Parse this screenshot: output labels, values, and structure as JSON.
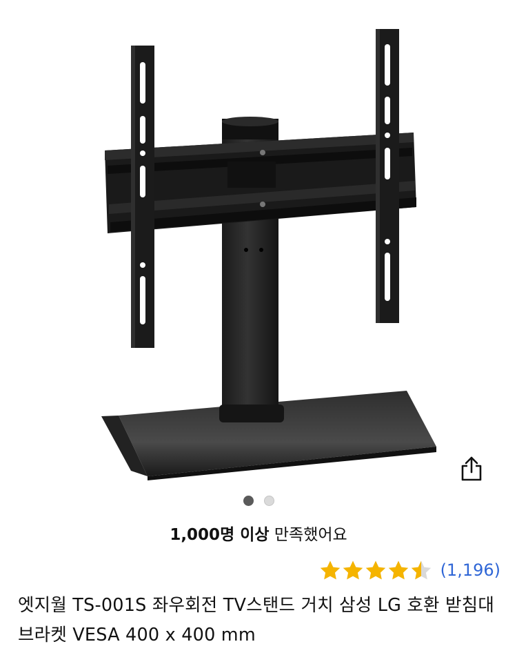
{
  "product": {
    "image_alt": "TV stand with VESA bracket",
    "gallery_count": 2,
    "gallery_active_index": 0
  },
  "satisfaction": {
    "count": "1,000명 이상",
    "suffix": " 만족했어요"
  },
  "rating": {
    "score": 4.5,
    "max": 5,
    "review_count": "(1,196)",
    "star_color": "#f5b400",
    "star_empty_color": "#d9d9d9"
  },
  "title": "엣지월 TS-001S 좌우회전 TV스탠드 거치 삼성 LG 호환 받침대 브라켓 VESA 400 x 400 mm",
  "icons": {
    "share": "share-icon",
    "star": "star-icon"
  },
  "colors": {
    "link": "#2f66d6",
    "dot_active": "#5a5a5a",
    "dot_inactive": "#dadada"
  }
}
